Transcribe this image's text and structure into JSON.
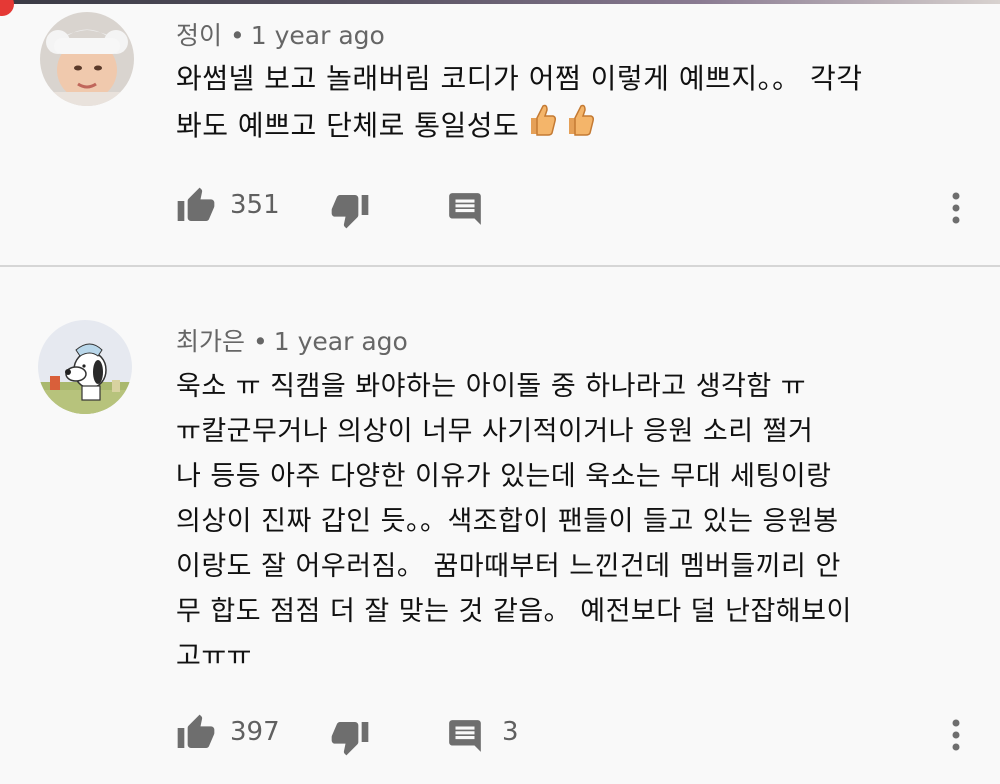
{
  "comments": [
    {
      "author": "정이",
      "time": "1 year ago",
      "text_lines": [
        "와썸넬 보고 놀래버림 코디가 어쩜 이렇게 예쁘지。。 각각",
        "봐도 예쁘고 단체로 통일성도"
      ],
      "emojis": [
        "thumbs-up-icon",
        "thumbs-up-icon"
      ],
      "likes": "351",
      "replies": ""
    },
    {
      "author": "최가은",
      "time": "1 year ago",
      "text_lines": [
        "욱소 ㅠ 직캠을 봐야하는 아이돌 중 하나라고 생각함 ㅠ",
        "ㅠ칼군무거나 의상이 너무 사기적이거나 응원 소리 쩔거",
        "나 등등 아주 다양한 이유가 있는데 욱소는 무대 세팅이랑",
        "의상이 진짜 갑인 듯。。색조합이 팬들이 들고 있는 응원봉",
        "이랑도 잘 어우러짐。 꿈마때부터 느낀건데 멤버들끼리 안",
        "무 합도 점점 더 잘 맞는 것 같음。 예전보다 덜 난잡해보이",
        "고ㅠㅠ"
      ],
      "likes": "397",
      "replies": "3"
    }
  ],
  "colors": {
    "background": "#f9f9f9",
    "icon": "#6e6e6e",
    "meta": "#666666"
  }
}
